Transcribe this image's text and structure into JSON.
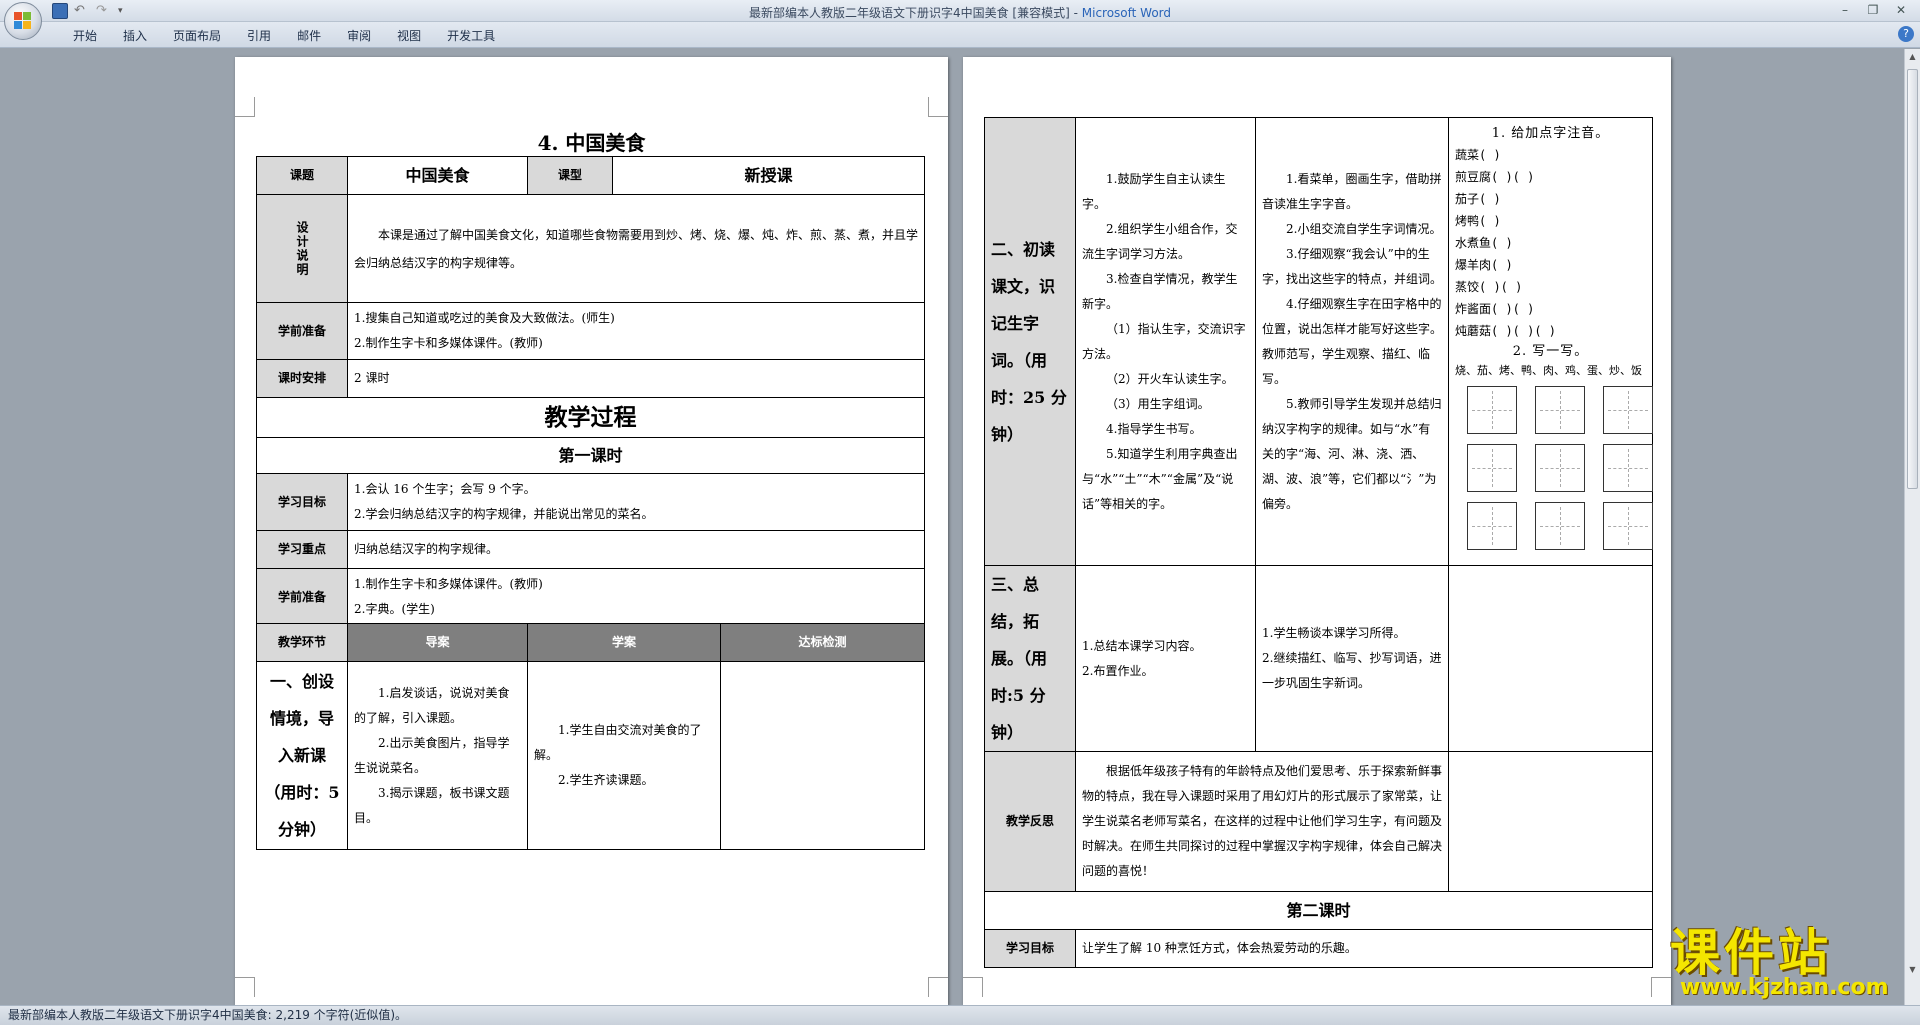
{
  "window": {
    "title_doc": "最新部编本人教版二年级语文下册识字4中国美食 [兼容模式] - ",
    "title_app": "Microsoft Word"
  },
  "ribbon": {
    "tabs": [
      "开始",
      "插入",
      "页面布局",
      "引用",
      "邮件",
      "审阅",
      "视图",
      "开发工具"
    ]
  },
  "status": {
    "text": "最新部编本人教版二年级语文下册识字4中国美食: 2,219 个字符(近似值)。"
  },
  "doc": {
    "title": "4. 中国美食",
    "topic_label": "课题",
    "topic_value": "中国美食",
    "type_label": "课型",
    "type_value": "新授课",
    "design_label": "设计说明",
    "design_text": "本课是通过了解中国美食文化，知道哪些食物需要用到炒、烤、烧、爆、炖、炸、煎、蒸、煮，并且学会归纳总结汉字的构字规律等。",
    "prep_label": "学前准备",
    "prep_items": [
      "1.搜集自己知道或吃过的美食及大致做法。(师生)",
      "2.制作生字卡和多媒体课件。(教师)"
    ],
    "hours_label": "课时安排",
    "hours_value": "2 课时",
    "process_title": "教学过程",
    "lesson1_title": "第一课时",
    "goal_label": "学习目标",
    "goal_items": [
      "1.会认 16 个生字；会写 9 个字。",
      "2.学会归纳总结汉字的构字规律，并能说出常见的菜名。"
    ],
    "focus_label": "学习重点",
    "focus_value": "归纳总结汉字的构字规律。",
    "prep2_label": "学前准备",
    "prep2_items": [
      "1.制作生字卡和多媒体课件。(教师)",
      "2.字典。(学生)"
    ],
    "stage_label": "教学环节",
    "col_guide": "导案",
    "col_study": "学案",
    "col_check": "达标检测",
    "step1_label": "一、创设情境，导入新课（用时：5 分钟）",
    "step1_guide": [
      "1.启发谈话，说说对美食的了解，引入课题。",
      "2.出示美食图片，指导学生说说菜名。",
      "3.揭示课题，板书课文题目。"
    ],
    "step1_study": [
      "1.学生自由交流对美食的了解。",
      "2.学生齐读课题。"
    ],
    "step2_label": "二、初读课文，识记生字词。（用时：25 分钟）",
    "step2_guide": [
      "1.鼓励学生自主认读生字。",
      "2.组织学生小组合作，交流生字词学习方法。",
      "3.检查自学情况，教学生新字。",
      "（1）指认生字，交流识字方法。",
      "（2）开火车认读生字。",
      "（3）用生字组词。",
      "4.指导学生书写。",
      "5.知道学生利用字典查出与“水”“土”“木”“金属”及“说话”等相关的字。"
    ],
    "step2_study": [
      "1.看菜单，圈画生字，借助拼音读准生字字音。",
      "2.小组交流自学生字词情况。",
      "3.仔细观察“我会认”中的生字，找出这些字的特点，并组词。",
      "4.仔细观察生字在田字格中的位置，说出怎样才能写好这些字。教师范写，学生观察、描红、临写。",
      "5.教师引导学生发现并总结归纳汉字构字的规律。如与“水”有关的字“海、河、淋、浇、洒、湖、波、浪”等，它们都以“氵”为偏旁。"
    ],
    "ex1_title": "1. 给加点字注音。",
    "ex1_items": [
      "蔬菜(    )",
      "煎豆腐(    )(    )",
      "茄子(    )",
      "烤鸭(    )",
      "水煮鱼(    )",
      "爆羊肉(    )",
      "蒸饺(    )(    )",
      "炸酱面(    )(    )",
      "炖蘑菇(    )(    )(    )"
    ],
    "ex2_title": "2. 写一写。",
    "ex2_chars": "烧、茄、烤、鸭、肉、鸡、蛋、炒、饭",
    "step3_label": "三、总结，拓展。（用时:5 分钟）",
    "step3_guide": [
      "1.总结本课学习内容。",
      "2.布置作业。"
    ],
    "step3_study": [
      "1.学生畅谈本课学习所得。",
      "2.继续描红、临写、抄写词语，进一步巩固生字新词。"
    ],
    "reflect_label": "教学反思",
    "reflect_text": "根据低年级孩子特有的年龄特点及他们爱思考、乐于探索新鲜事物的特点，我在导入课题时采用了用幻灯片的形式展示了家常菜，让学生说菜名老师写菜名，在这样的过程中让他们学习生字，有问题及时解决。在师生共同探讨的过程中掌握汉字构字规律，体会自己解决问题的喜悦！",
    "lesson2_title": "第二课时",
    "goal2_label": "学习目标",
    "goal2_value": "让学生了解 10 种烹饪方式，体会热爱劳动的乐趣。"
  },
  "watermark": {
    "cn": "课件站",
    "url": "www.kjzhan.com"
  }
}
